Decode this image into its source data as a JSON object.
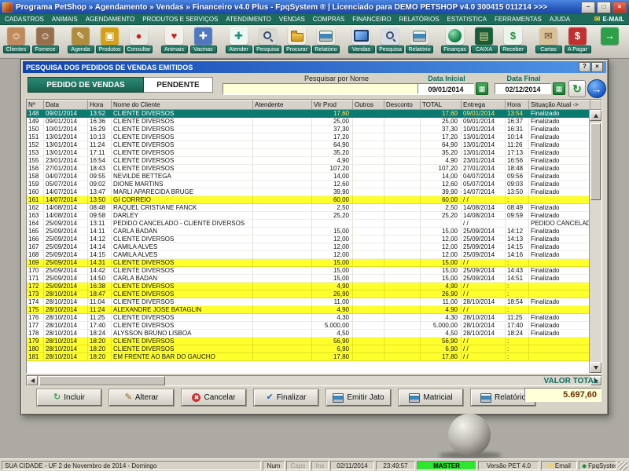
{
  "window": {
    "title": "Programa PetShop » Agendamento » Vendas » Financeiro v4.0 Plus - FpqSystem ® | Licenciado para  DEMO PETSHOP v4.0 300415 011214 >>>",
    "controls": {
      "minimize": "–",
      "maximize": "□",
      "close": "×"
    }
  },
  "menu": {
    "items": [
      "CADASTROS",
      "ANIMAIS",
      "AGENDAMENTO",
      "PRODUTOS E SERVIÇOS",
      "ATENDIMENTO",
      "VENDAS",
      "COMPRAS",
      "FINANCEIRO",
      "RELATÓRIOS",
      "ESTATISTICA",
      "FERRAMENTAS",
      "AJUDA"
    ],
    "email_label": "E-MAIL"
  },
  "toolbar": {
    "items": [
      {
        "label": "Clientes",
        "icon": "clients-icon"
      },
      {
        "label": "Fornece",
        "icon": "suppliers-icon"
      },
      {
        "label": "Agenda",
        "icon": "agenda-icon"
      },
      {
        "label": "Produtos",
        "icon": "products-icon"
      },
      {
        "label": "Consultar",
        "icon": "consult-icon"
      },
      {
        "label": "Animais",
        "icon": "animals-icon"
      },
      {
        "label": "Vacinas",
        "icon": "vaccines-icon"
      },
      {
        "label": "Atender",
        "icon": "attend-icon"
      },
      {
        "label": "Pesquisa",
        "icon": "search-icon"
      },
      {
        "label": "Procurar",
        "icon": "folder-search-icon"
      },
      {
        "label": "Relatório",
        "icon": "report-icon"
      },
      {
        "label": "Vendas",
        "icon": "sales-icon"
      },
      {
        "label": "Pesquisa",
        "icon": "sales-search-icon"
      },
      {
        "label": "Relatório",
        "icon": "sales-report-icon"
      },
      {
        "label": "Finanças",
        "icon": "finance-icon"
      },
      {
        "label": "CAIXA",
        "icon": "cash-register-icon"
      },
      {
        "label": "Receber",
        "icon": "receive-icon"
      },
      {
        "label": "Cartas",
        "icon": "letters-icon"
      },
      {
        "label": "A Pagar",
        "icon": "pay-icon"
      },
      {
        "label": "",
        "icon": "exit-icon"
      }
    ]
  },
  "dialog": {
    "title": "PESQUISA DOS PEDIDOS DE VENDAS EMITIDOS",
    "controls": {
      "help": "?",
      "close": "×"
    },
    "order_type": "PEDIDO DE VENDAS",
    "order_status": "PENDENTE",
    "search": {
      "label": "Pesquisar por Nome",
      "value": ""
    },
    "date_start": {
      "label": "Data Inicial",
      "value": "09/01/2014"
    },
    "date_end": {
      "label": "Data Final",
      "value": "02/12/2014"
    },
    "grid": {
      "columns": [
        "Nº",
        "Data",
        "Hora",
        "Nome do Cliente",
        "Atendente",
        "Vlr Prod",
        "Outros",
        "Desconto",
        "TOTAL",
        "Entrega",
        "Hora",
        "Situação Atual ->"
      ],
      "rows": [
        {
          "cells": [
            "148",
            "09/01/2014",
            "13:52",
            "CLIENTE DIVERSOS",
            "",
            "17,60",
            "",
            "",
            "17,60",
            "09/01/2014",
            "13:54",
            "Finalizado"
          ],
          "state": "selected"
        },
        {
          "cells": [
            "149",
            "09/01/2014",
            "16:36",
            "CLIENTE DIVERSOS",
            "",
            "25,00",
            "",
            "",
            "25,00",
            "09/01/2014",
            "16:37",
            "Finalizado"
          ],
          "state": "normal"
        },
        {
          "cells": [
            "150",
            "10/01/2014",
            "16:29",
            "CLIENTE DIVERSOS",
            "",
            "37,30",
            "",
            "",
            "37,30",
            "10/01/2014",
            "16:31",
            "Finalizado"
          ],
          "state": "normal"
        },
        {
          "cells": [
            "151",
            "13/01/2014",
            "10:13",
            "CLIENTE DIVERSOS",
            "",
            "17,20",
            "",
            "",
            "17,20",
            "13/01/2014",
            "10:14",
            "Finalizado"
          ],
          "state": "normal"
        },
        {
          "cells": [
            "152",
            "13/01/2014",
            "11:24",
            "CLIENTE DIVERSOS",
            "",
            "64,90",
            "",
            "",
            "64,90",
            "13/01/2014",
            "11:26",
            "Finalizado"
          ],
          "state": "normal"
        },
        {
          "cells": [
            "153",
            "13/01/2014",
            "17:11",
            "CLIENTE DIVERSOS",
            "",
            "35,20",
            "",
            "",
            "35,20",
            "13/01/2014",
            "17:13",
            "Finalizado"
          ],
          "state": "normal"
        },
        {
          "cells": [
            "155",
            "23/01/2014",
            "16:54",
            "CLIENTE DIVERSOS",
            "",
            "4,90",
            "",
            "",
            "4,90",
            "23/01/2014",
            "16:56",
            "Finalizado"
          ],
          "state": "normal"
        },
        {
          "cells": [
            "156",
            "27/01/2014",
            "18:43",
            "CLIENTE DIVERSOS",
            "",
            "107,20",
            "",
            "",
            "107,20",
            "27/01/2014",
            "18:48",
            "Finalizado"
          ],
          "state": "normal"
        },
        {
          "cells": [
            "158",
            "04/07/2014",
            "09:55",
            "NEVILDE BETTEGA",
            "",
            "14,00",
            "",
            "",
            "14,00",
            "04/07/2014",
            "09:56",
            "Finalizado"
          ],
          "state": "normal"
        },
        {
          "cells": [
            "159",
            "05/07/2014",
            "09:02",
            "DIONE MARTINS",
            "",
            "12,60",
            "",
            "",
            "12,60",
            "05/07/2014",
            "09:03",
            "Finalizado"
          ],
          "state": "normal"
        },
        {
          "cells": [
            "160",
            "14/07/2014",
            "13:47",
            "MARLI APARECIDA BRUGE",
            "",
            "39,90",
            "",
            "",
            "39,90",
            "14/07/2014",
            "13:50",
            "Finalizado"
          ],
          "state": "normal"
        },
        {
          "cells": [
            "161",
            "14/07/2014",
            "13:50",
            "GI CORREIO",
            "",
            "60,00",
            "",
            "",
            "60,00",
            "/  /",
            ":",
            ""
          ],
          "state": "pending"
        },
        {
          "cells": [
            "162",
            "14/08/2014",
            "08:48",
            "RAQUEL CRISTIANE FANCK",
            "",
            "2,50",
            "",
            "",
            "2,50",
            "14/08/2014",
            "08:49",
            "Finalizado"
          ],
          "state": "normal"
        },
        {
          "cells": [
            "163",
            "14/08/2014",
            "09:58",
            "DARLEY",
            "",
            "25,20",
            "",
            "",
            "25,20",
            "14/08/2014",
            "09:59",
            "Finalizado"
          ],
          "state": "normal"
        },
        {
          "cells": [
            "164",
            "25/09/2014",
            "13:11",
            "PEDIDO CANCELADO - CLIENTE DIVERSOS",
            "",
            "",
            "",
            "",
            "",
            "/  /",
            "",
            "PEDIDO CANCELADO"
          ],
          "state": "normal"
        },
        {
          "cells": [
            "165",
            "25/09/2014",
            "14:11",
            "CARLA BADAN",
            "",
            "15,00",
            "",
            "",
            "15,00",
            "25/09/2014",
            "14:12",
            "Finalizado"
          ],
          "state": "normal"
        },
        {
          "cells": [
            "166",
            "25/09/2014",
            "14:12",
            "CLIENTE DIVERSOS",
            "",
            "12,00",
            "",
            "",
            "12,00",
            "25/09/2014",
            "14:13",
            "Finalizado"
          ],
          "state": "normal"
        },
        {
          "cells": [
            "167",
            "25/09/2014",
            "14:14",
            "CAMILA ALVES",
            "",
            "12,00",
            "",
            "",
            "12,00",
            "25/09/2014",
            "14:15",
            "Finalizado"
          ],
          "state": "normal"
        },
        {
          "cells": [
            "168",
            "25/09/2014",
            "14:15",
            "CAMILA ALVES",
            "",
            "12,00",
            "",
            "",
            "12,00",
            "25/09/2014",
            "14:16",
            "Finalizado"
          ],
          "state": "normal"
        },
        {
          "cells": [
            "169",
            "25/09/2014",
            "14:31",
            "CLIENTE DIVERSOS",
            "",
            "15,00",
            "",
            "",
            "15,00",
            "/  /",
            ":",
            ""
          ],
          "state": "pending"
        },
        {
          "cells": [
            "170",
            "25/09/2014",
            "14:42",
            "CLIENTE DIVERSOS",
            "",
            "15,00",
            "",
            "",
            "15,00",
            "25/09/2014",
            "14:43",
            "Finalizado"
          ],
          "state": "normal"
        },
        {
          "cells": [
            "171",
            "25/09/2014",
            "14:50",
            "CARLA BADAN",
            "",
            "15,00",
            "",
            "",
            "15,00",
            "25/09/2014",
            "14:51",
            "Finalizado"
          ],
          "state": "normal"
        },
        {
          "cells": [
            "172",
            "25/09/2014",
            "16:38",
            "CLIENTE DIVERSOS",
            "",
            "4,90",
            "",
            "",
            "4,90",
            "/  /",
            ":",
            ""
          ],
          "state": "pending"
        },
        {
          "cells": [
            "173",
            "28/10/2014",
            "18:47",
            "CLIENTE DIVERSOS",
            "",
            "26,90",
            "",
            "",
            "26,90",
            "/  /",
            ":",
            ""
          ],
          "state": "pending"
        },
        {
          "cells": [
            "174",
            "28/10/2014",
            "11:04",
            "CLIENTE DIVERSOS",
            "",
            "11,00",
            "",
            "",
            "11,00",
            "28/10/2014",
            "18:54",
            "Finalizado"
          ],
          "state": "normal"
        },
        {
          "cells": [
            "175",
            "28/10/2014",
            "11:24",
            "ALEXANDRE JOSE BATAGLIN",
            "",
            "4,90",
            "",
            "",
            "4,90",
            "/  /",
            ":",
            ""
          ],
          "state": "pending"
        },
        {
          "cells": [
            "176",
            "28/10/2014",
            "11:25",
            "CLIENTE DIVERSOS",
            "",
            "4,30",
            "",
            "",
            "4,30",
            "28/10/2014",
            "11:25",
            "Finalizado"
          ],
          "state": "normal"
        },
        {
          "cells": [
            "177",
            "28/10/2014",
            "17:40",
            "CLIENTE DIVERSOS",
            "",
            "5.000,00",
            "",
            "",
            "5.000,00",
            "28/10/2014",
            "17:40",
            "Finalizado"
          ],
          "state": "normal"
        },
        {
          "cells": [
            "178",
            "28/10/2014",
            "18:24",
            "ALYSSON BRUNO LISBOA",
            "",
            "4,50",
            "",
            "",
            "4,50",
            "28/10/2014",
            "18:24",
            "Finalizado"
          ],
          "state": "normal"
        },
        {
          "cells": [
            "179",
            "28/10/2014",
            "18:20",
            "CLIENTE DIVERSOS",
            "",
            "56,90",
            "",
            "",
            "56,90",
            "/  /",
            ":",
            ""
          ],
          "state": "pending"
        },
        {
          "cells": [
            "180",
            "28/10/2014",
            "18:20",
            "CLIENTE DIVERSOS",
            "",
            "6,90",
            "",
            "",
            "6,90",
            "/  /",
            ":",
            ""
          ],
          "state": "pending"
        },
        {
          "cells": [
            "181",
            "28/10/2014",
            "18:20",
            "EM FRENTE AO BAR DO GAUCHO",
            "",
            "17,80",
            "",
            "",
            "17,80",
            "/  /",
            ":",
            ""
          ],
          "state": "pending"
        }
      ]
    },
    "buttons": [
      {
        "label": "Incluir",
        "icon": "add-icon"
      },
      {
        "label": "Alterar",
        "icon": "edit-icon"
      },
      {
        "label": "Cancelar",
        "icon": "cancel-icon"
      },
      {
        "label": "Finalizar",
        "icon": "finalize-icon"
      },
      {
        "label": "Emitir Jato",
        "icon": "inkjet-printer-icon"
      },
      {
        "label": "Matricial",
        "icon": "matrix-printer-icon"
      },
      {
        "label": "Relatório",
        "icon": "report-printer-icon"
      }
    ],
    "total": {
      "label": "VALOR TOTAL",
      "value": "5.697,60"
    }
  },
  "statusbar": {
    "location": "SUA CIDADE - UF  2 de Novembro de 2014 - Domingo",
    "num": "Num",
    "caps": "Caps",
    "ins": "Ins",
    "date": "02/11/2014",
    "time": "23:49:57",
    "user": "MASTER",
    "version": "Versão PET 4.0",
    "email": "Email",
    "brand": "FpqSystem"
  }
}
